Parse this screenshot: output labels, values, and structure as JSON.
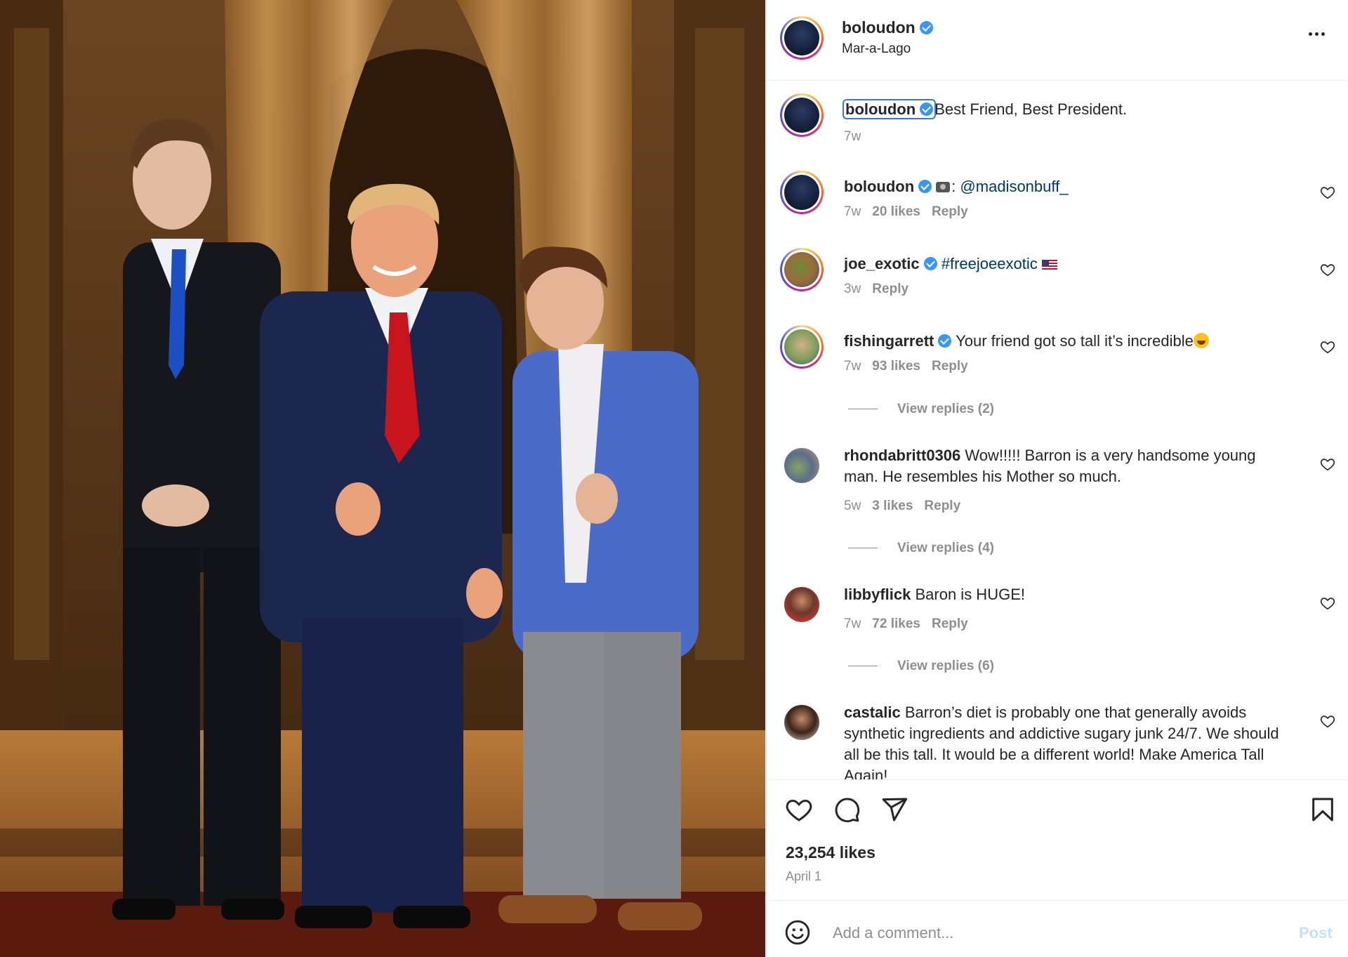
{
  "post": {
    "username": "boloudon",
    "location": "Mar-a-Lago",
    "caption": "Best Friend, Best President.",
    "caption_time": "7w",
    "likes": "23,254 likes",
    "date": "April 1",
    "comment_placeholder": "Add a comment...",
    "post_label": "Post"
  },
  "comments": [
    {
      "user": "boloudon",
      "text": ": @madisonbuff_",
      "mention": "@madisonbuff_",
      "time": "7w",
      "likes": "20 likes",
      "reply": "Reply"
    },
    {
      "user": "joe_exotic",
      "text": "#freejoeexotic",
      "time": "3w",
      "reply": "Reply"
    },
    {
      "user": "fishingarrett",
      "text": "Your friend got so tall it’s incredible",
      "time": "7w",
      "likes": "93 likes",
      "reply": "Reply",
      "view_replies": "View replies (2)"
    },
    {
      "user": "rhondabritt0306",
      "text": "Wow!!!!! Barron is a very handsome young man. He resembles his Mother so much.",
      "time": "5w",
      "likes": "3 likes",
      "reply": "Reply",
      "view_replies": "View replies (4)"
    },
    {
      "user": "libbyflick",
      "text": "Baron is HUGE!",
      "time": "7w",
      "likes": "72 likes",
      "reply": "Reply",
      "view_replies": "View replies (6)"
    },
    {
      "user": "castalic",
      "text": "Barron’s diet is probably one that generally avoids synthetic ingredients and addictive sugary junk 24/7. We should all be this tall. It would be a different world! Make America Tall Again!"
    }
  ],
  "icons": {
    "verified": "verified-badge-icon",
    "heart": "heart-icon",
    "comment": "comment-icon",
    "share": "share-icon",
    "save": "bookmark-icon",
    "more": "more-options-icon",
    "emoji": "emoji-icon"
  },
  "colors": {
    "verified": "#3897f0",
    "link": "#00376b",
    "muted": "#8e8e8e",
    "focus": "#3a74e7"
  }
}
